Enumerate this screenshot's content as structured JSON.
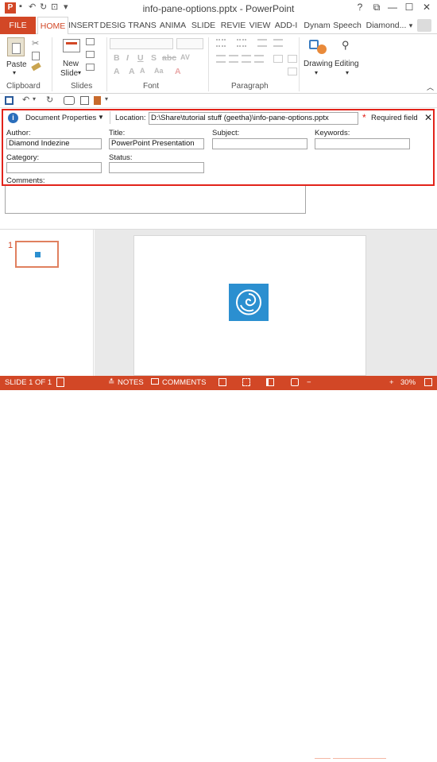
{
  "window": {
    "title": "info-pane-options.pptx - PowerPoint",
    "help": "?",
    "restore": "⧉",
    "minimize": "—",
    "maximize": "☐",
    "close": "✕"
  },
  "tabs": [
    {
      "label": "FILE"
    },
    {
      "label": "HOME"
    },
    {
      "label": "INSERT"
    },
    {
      "label": "DESIG"
    },
    {
      "label": "TRANS"
    },
    {
      "label": "ANIMA"
    },
    {
      "label": "SLIDE S"
    },
    {
      "label": "REVIE"
    },
    {
      "label": "VIEW"
    },
    {
      "label": "ADD-I"
    },
    {
      "label": "Dynam"
    },
    {
      "label": "Speech"
    }
  ],
  "user": {
    "name": "Diamond...",
    "dropdown": "▾"
  },
  "ribbon": {
    "paste": "Paste",
    "new_slide_1": "New",
    "new_slide_2": "Slide",
    "clipboard": "Clipboard",
    "slides": "Slides",
    "font": "Font",
    "paragraph": "Paragraph",
    "drawing": "Drawing",
    "editing": "Editing"
  },
  "info": {
    "properties_label": "Document Properties",
    "location_label": "Location:",
    "location_value": "D:\\Share\\tutorial stuff (geetha)\\info-pane-options.pptx",
    "required": "Required field",
    "required_star": "*",
    "author_label": "Author:",
    "author_value": "Diamond Indezine",
    "title_label": "Title:",
    "title_value": "PowerPoint Presentation",
    "subject_label": "Subject:",
    "subject_value": "",
    "keywords_label": "Keywords:",
    "keywords_value": "",
    "category_label": "Category:",
    "category_value": "",
    "status_label": "Status:",
    "status_value": "",
    "comments_label": "Comments:"
  },
  "thumbnail": {
    "number": "1"
  },
  "status": {
    "slide": "SLIDE 1 OF 1",
    "notes": "NOTES",
    "comments": "COMMENTS",
    "zoom": "30%"
  },
  "colors": {
    "accent": "#d24726",
    "pane_border": "#e2231a",
    "logo": "#2b8fd0"
  }
}
